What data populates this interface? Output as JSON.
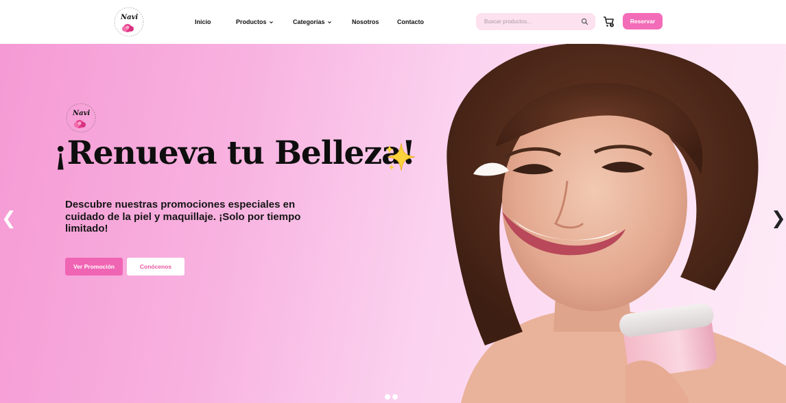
{
  "header": {
    "logo_alt": "Navi",
    "nav": [
      {
        "label": "Inicio",
        "dropdown": false
      },
      {
        "label": "Productos",
        "dropdown": true
      },
      {
        "label": "Categorías",
        "dropdown": true
      },
      {
        "label": "Nosotros",
        "dropdown": false
      },
      {
        "label": "Contacto",
        "dropdown": false
      }
    ],
    "search": {
      "placeholder": "Buscar productos...",
      "value": ""
    },
    "cart_icon": "cart-icon",
    "reserve_label": "Reservar"
  },
  "hero": {
    "title": "¡Renueva tu Belleza!",
    "subtitle": "Descubre nuestras promociones especiales en cuidado de la piel y maquillaje. ¡Solo por tiempo limitado!",
    "primary_button": "Ver Promoción",
    "secondary_button": "Conócenos",
    "prev_arrow": "❮",
    "next_arrow": "❯",
    "slides": 2,
    "active_slide": 1
  },
  "colors": {
    "accent": "#f36cb8",
    "hero_start": "#f59ad4",
    "hero_end": "#fdeaf7",
    "search_bg": "#fde1ee"
  }
}
